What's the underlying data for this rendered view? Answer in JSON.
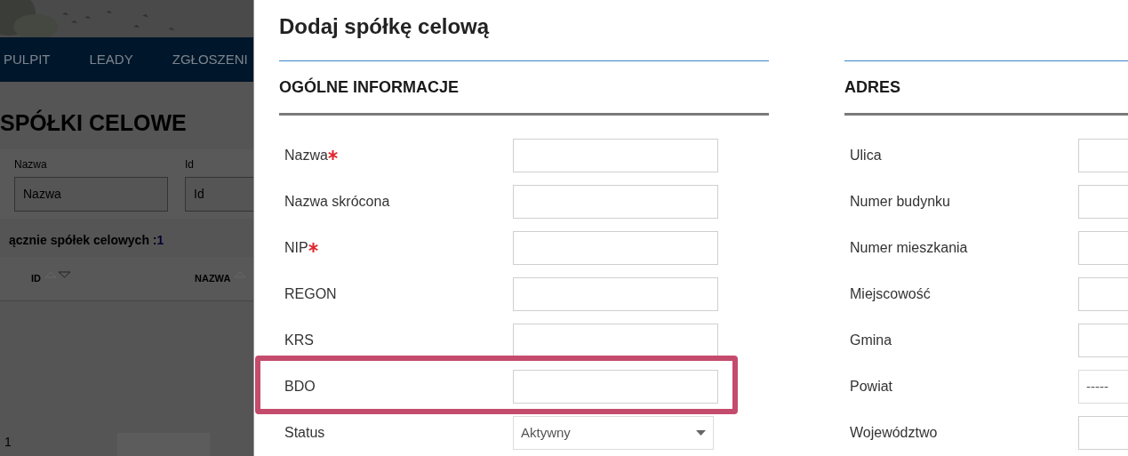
{
  "background_page": {
    "nav": [
      "PULPIT",
      "LEADY",
      "ZGŁOSZENI"
    ],
    "title": "SPÓŁKI CELOWE",
    "filters": [
      {
        "label": "Nazwa",
        "placeholder": "Nazwa"
      },
      {
        "label": "Id",
        "placeholder": "Id"
      }
    ],
    "total": {
      "label": "ącznie spółek celowych : ",
      "count": "1"
    },
    "table": {
      "columns": [
        "ID",
        "NAZWA"
      ]
    },
    "pagination": "1"
  },
  "modal": {
    "title": "Dodaj spółkę celową",
    "sections": [
      {
        "heading": "OGÓLNE INFORMACJE",
        "fields": [
          {
            "label": "Nazwa",
            "kind": "text",
            "required": true,
            "highlighted": false
          },
          {
            "label": "Nazwa skrócona",
            "kind": "text",
            "required": false,
            "highlighted": false
          },
          {
            "label": "NIP",
            "kind": "text",
            "required": true,
            "highlighted": false
          },
          {
            "label": "REGON",
            "kind": "text",
            "required": false,
            "highlighted": false
          },
          {
            "label": "KRS",
            "kind": "text",
            "required": false,
            "highlighted": false
          },
          {
            "label": "BDO",
            "kind": "text",
            "required": false,
            "highlighted": true
          },
          {
            "label": "Status",
            "kind": "select",
            "value": "Aktywny",
            "caret": true,
            "required": false,
            "highlighted": false
          }
        ]
      },
      {
        "heading": "ADRES",
        "fields": [
          {
            "label": "Ulica",
            "kind": "text",
            "required": false,
            "highlighted": false
          },
          {
            "label": "Numer budynku",
            "kind": "text",
            "required": false,
            "highlighted": false
          },
          {
            "label": "Numer mieszkania",
            "kind": "text",
            "required": false,
            "highlighted": false
          },
          {
            "label": "Miejscowość",
            "kind": "text",
            "required": false,
            "highlighted": false
          },
          {
            "label": "Gmina",
            "kind": "text",
            "required": false,
            "highlighted": false
          },
          {
            "label": "Powiat",
            "kind": "select",
            "value": "-----",
            "caret": false,
            "required": false,
            "highlighted": false
          },
          {
            "label": "Województwo",
            "kind": "text",
            "required": false,
            "highlighted": false
          }
        ]
      }
    ]
  }
}
